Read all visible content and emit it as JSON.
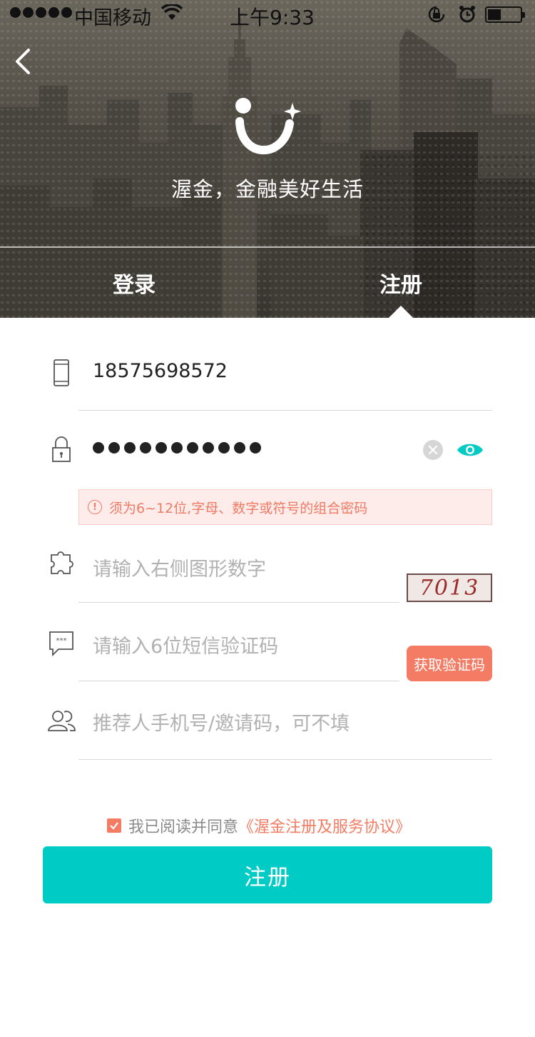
{
  "status_bar": {
    "carrier": "中国移动",
    "time": "上午9:33",
    "signal_icon": "signal-dots-icon",
    "wifi_icon": "wifi-icon",
    "lock_icon": "rotation-lock-icon",
    "alarm_icon": "alarm-icon",
    "battery_icon": "battery-icon"
  },
  "header": {
    "back_icon": "chevron-left-icon",
    "logo_icon": "brand-logo-icon",
    "slogan": "渥金，金融美好生活",
    "tabs": [
      {
        "label": "登录",
        "active": false
      },
      {
        "label": "注册",
        "active": true
      }
    ]
  },
  "form": {
    "phone": {
      "icon": "mobile-phone-icon",
      "value": "18575698572"
    },
    "password": {
      "icon": "padlock-icon",
      "masked_length": 11,
      "clear_icon": "clear-icon",
      "toggle_icon": "eye-icon",
      "warning": "须为6~12位,字母、数字或符号的组合密码",
      "warning_icon": "exclamation-icon"
    },
    "captcha": {
      "icon": "puzzle-icon",
      "placeholder": "请输入右侧图形数字",
      "image_text": "7013"
    },
    "sms": {
      "icon": "sms-message-icon",
      "placeholder": "请输入6位短信验证码",
      "button_label": "获取验证码"
    },
    "referrer": {
      "icon": "users-icon",
      "placeholder": "推荐人手机号/邀请码，可不填"
    }
  },
  "agreement": {
    "checked": true,
    "text": "我已阅读并同意",
    "link": "《渥金注册及服务协议》"
  },
  "submit_label": "注册",
  "colors": {
    "accent": "#00cbc4",
    "orange": "#f47c64",
    "warning_bg": "#fdecea"
  }
}
